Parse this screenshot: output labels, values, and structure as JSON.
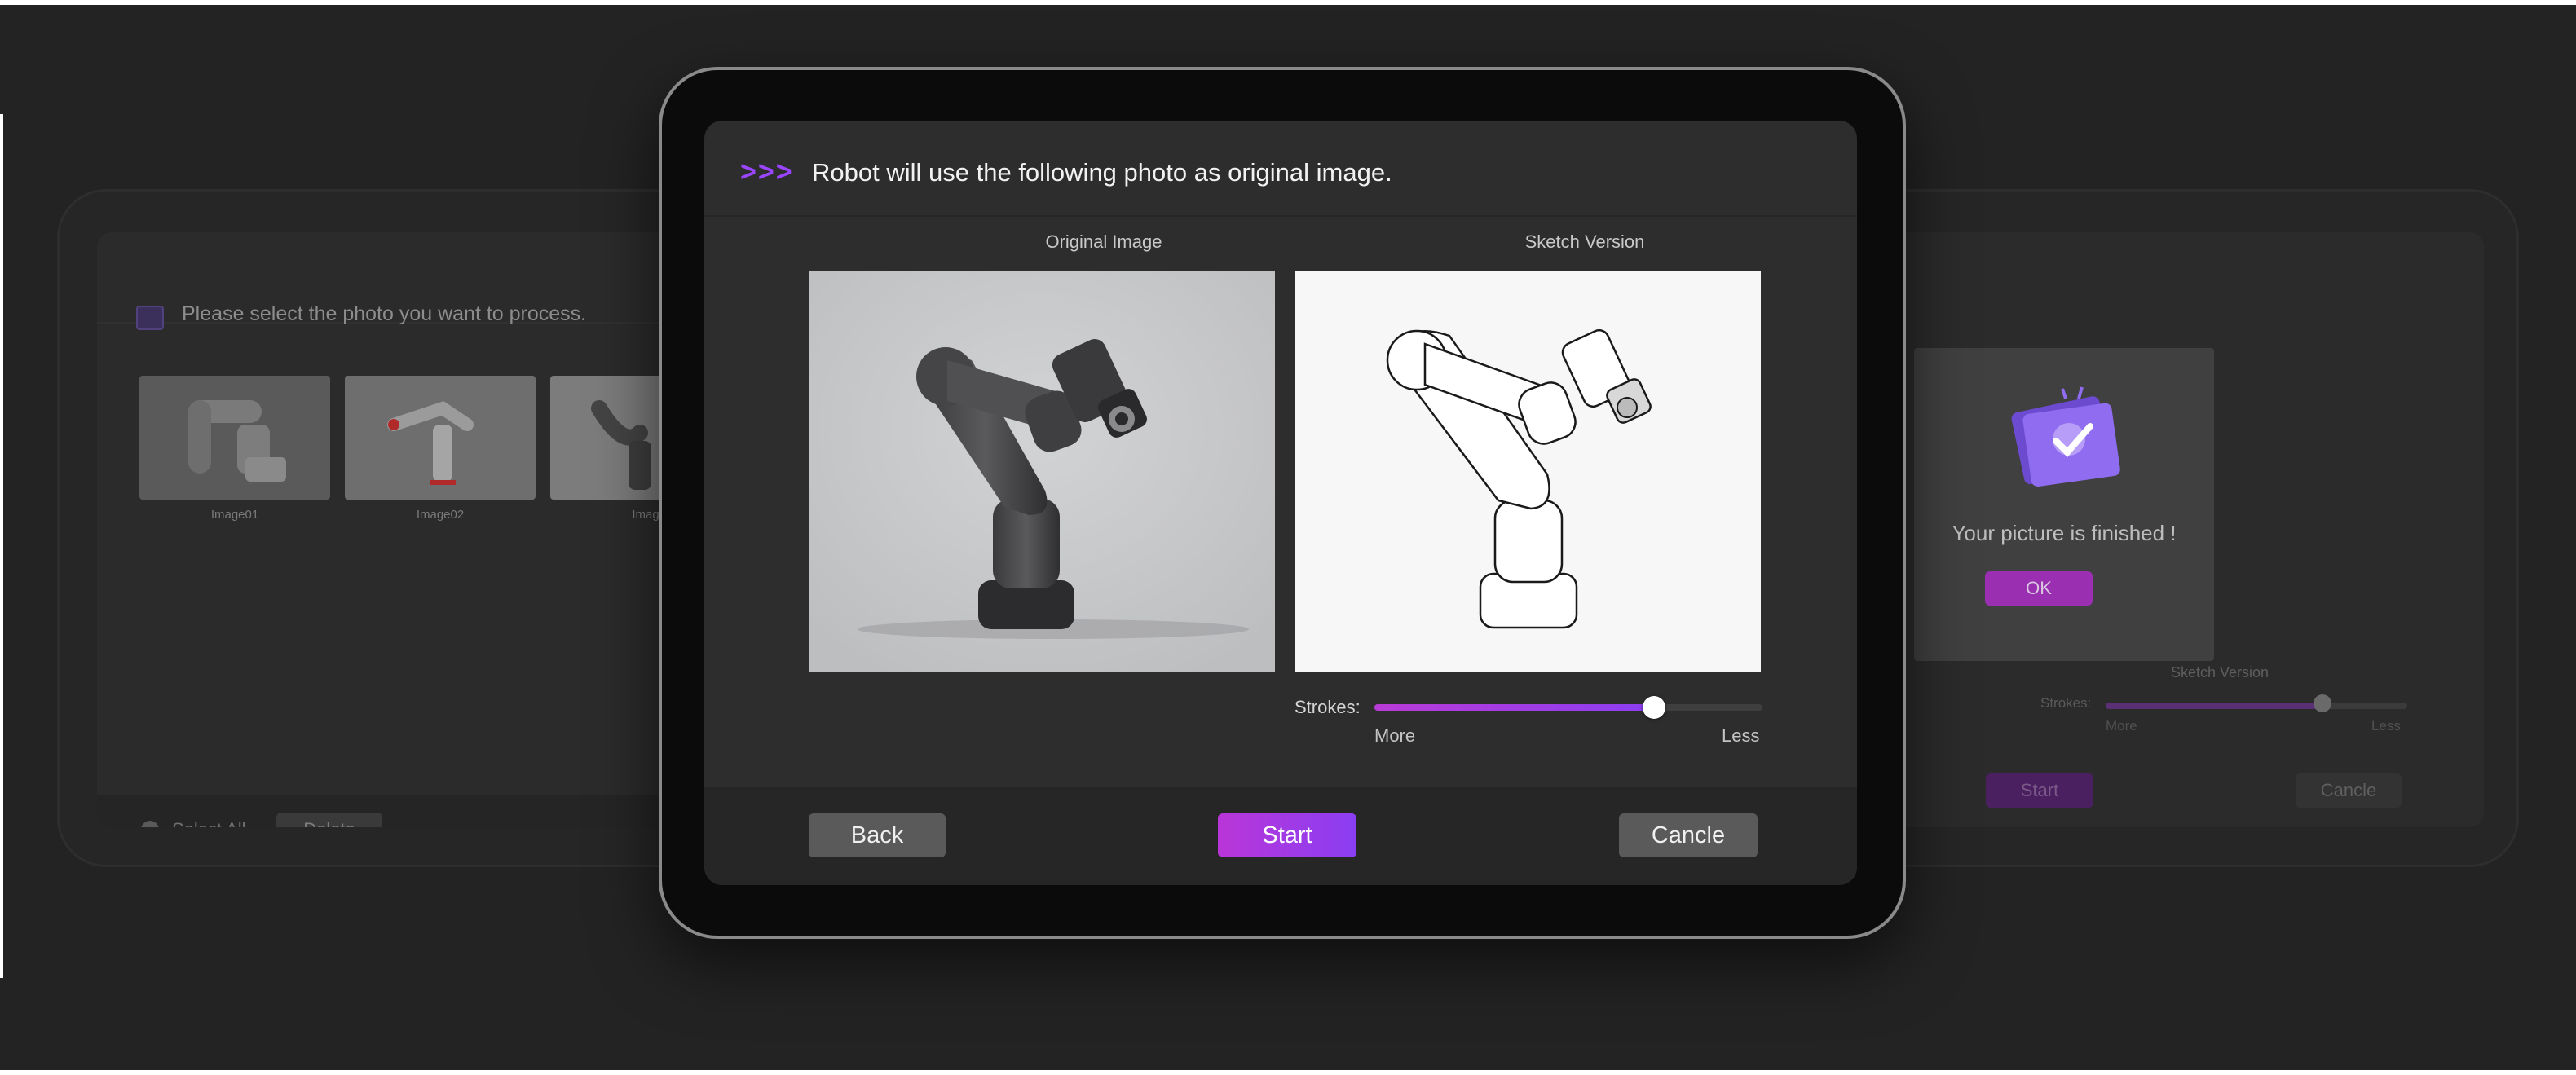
{
  "left_screen": {
    "title": "Please select the photo you want to process.",
    "thumbnails": [
      {
        "caption": "Image01"
      },
      {
        "caption": "Image02"
      },
      {
        "caption": "Imag"
      }
    ],
    "select_all_label": "Select All",
    "delete_label": "Delete"
  },
  "right_screen": {
    "message": "Your picture is finished !",
    "ok_label": "OK",
    "sketch_label": "Sketch Version",
    "strokes_label": "Strokes:",
    "more_label": "More",
    "less_label": "Less",
    "start_label": "Start",
    "cancel_label": "Cancle",
    "slider_fraction": 0.72
  },
  "main_screen": {
    "header_arrows": ">>>",
    "title": "Robot will use the following photo as original image.",
    "original_label": "Original Image",
    "sketch_label": "Sketch Version",
    "strokes_label": "Strokes:",
    "more_label": "More",
    "less_label": "Less",
    "slider_fraction": 0.72,
    "back_label": "Back",
    "start_label": "Start",
    "cancel_label": "Cancle"
  },
  "colors": {
    "background": "#232323",
    "accent_purple": "#9a45ff",
    "accent_magenta": "#b936d8",
    "button_gray": "#5a5a5a"
  }
}
